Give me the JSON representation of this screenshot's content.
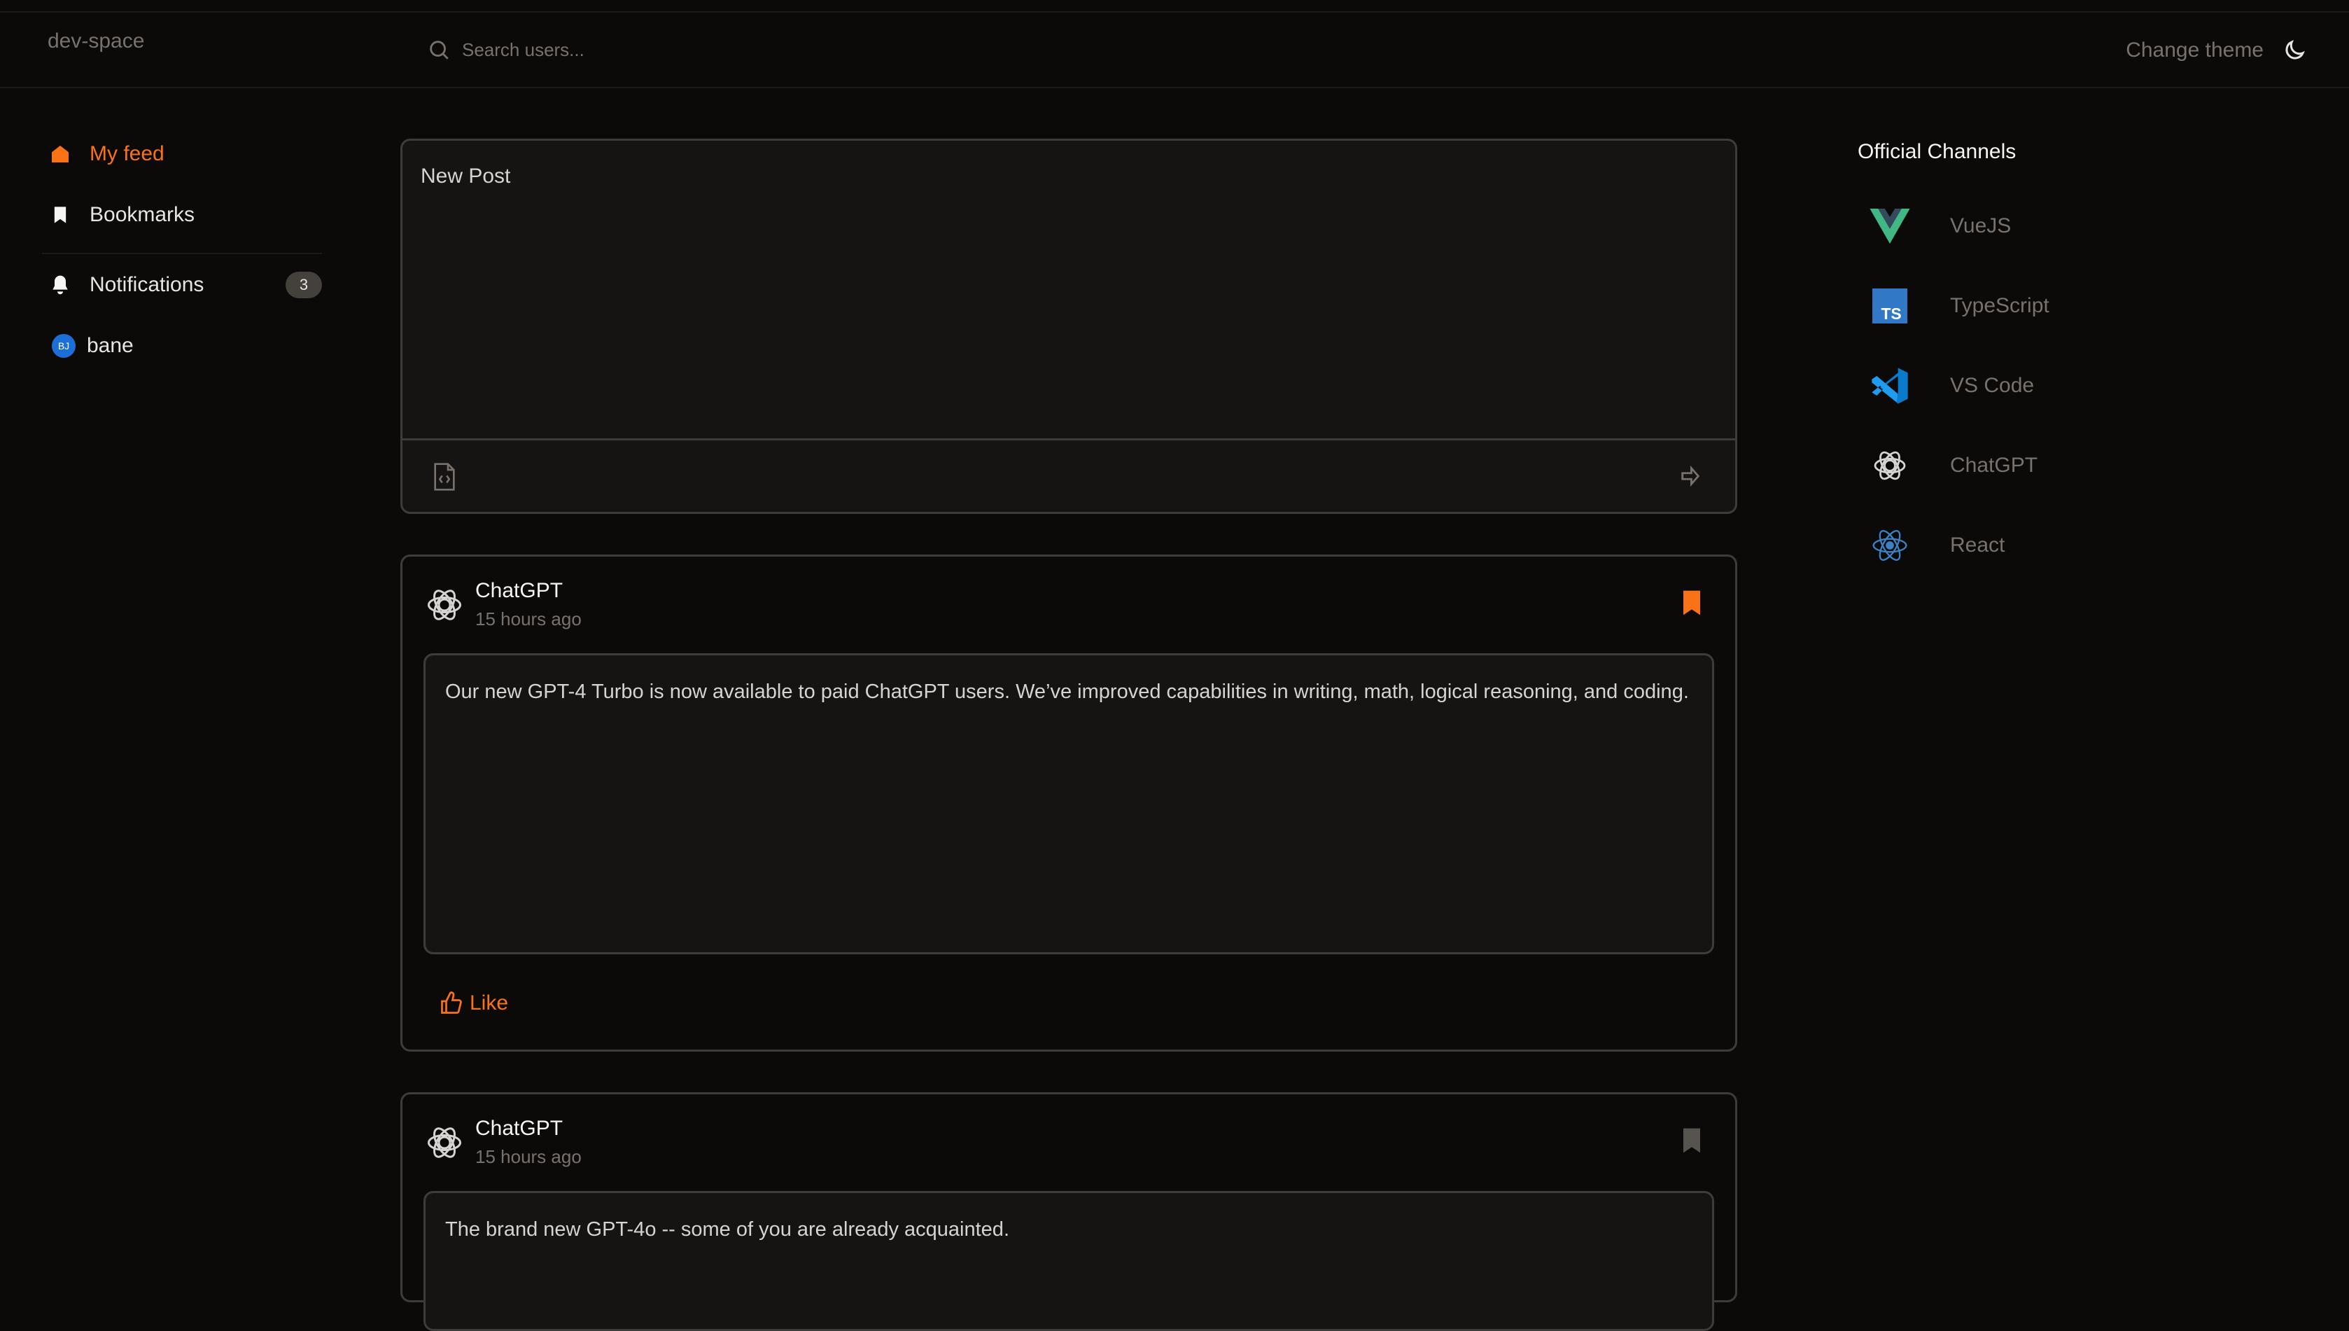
{
  "brand": "dev-space",
  "search": {
    "placeholder": "Search users..."
  },
  "theme": {
    "label": "Change theme"
  },
  "sidebar": {
    "items": [
      {
        "label": "My feed",
        "icon": "home-icon",
        "active": true
      },
      {
        "label": "Bookmarks",
        "icon": "bookmark-icon"
      },
      {
        "label": "Notifications",
        "icon": "bell-icon",
        "badge": "3"
      },
      {
        "label": "bane",
        "avatar": "BJ"
      }
    ]
  },
  "composer": {
    "placeholder": "New Post"
  },
  "posts": [
    {
      "author": "ChatGPT",
      "time": "15 hours ago",
      "body": "Our new GPT-4 Turbo is now available to paid ChatGPT users. We’ve improved capabilities in writing, math, logical reasoning, and coding.",
      "bookmarked": true,
      "like": "Like"
    },
    {
      "author": "ChatGPT",
      "time": "15 hours ago",
      "body": "The brand new GPT-4o -- some of you are already acquainted.",
      "bookmarked": false
    }
  ],
  "channels": {
    "title": "Official Channels",
    "items": [
      {
        "label": "VueJS",
        "icon": "vue-icon"
      },
      {
        "label": "TypeScript",
        "icon": "typescript-icon"
      },
      {
        "label": "VS Code",
        "icon": "vscode-icon"
      },
      {
        "label": "ChatGPT",
        "icon": "chatgpt-icon"
      },
      {
        "label": "React",
        "icon": "react-icon"
      }
    ]
  },
  "colors": {
    "accent": "#f97316",
    "background": "#0c0a09",
    "border": "#3f3b39"
  }
}
